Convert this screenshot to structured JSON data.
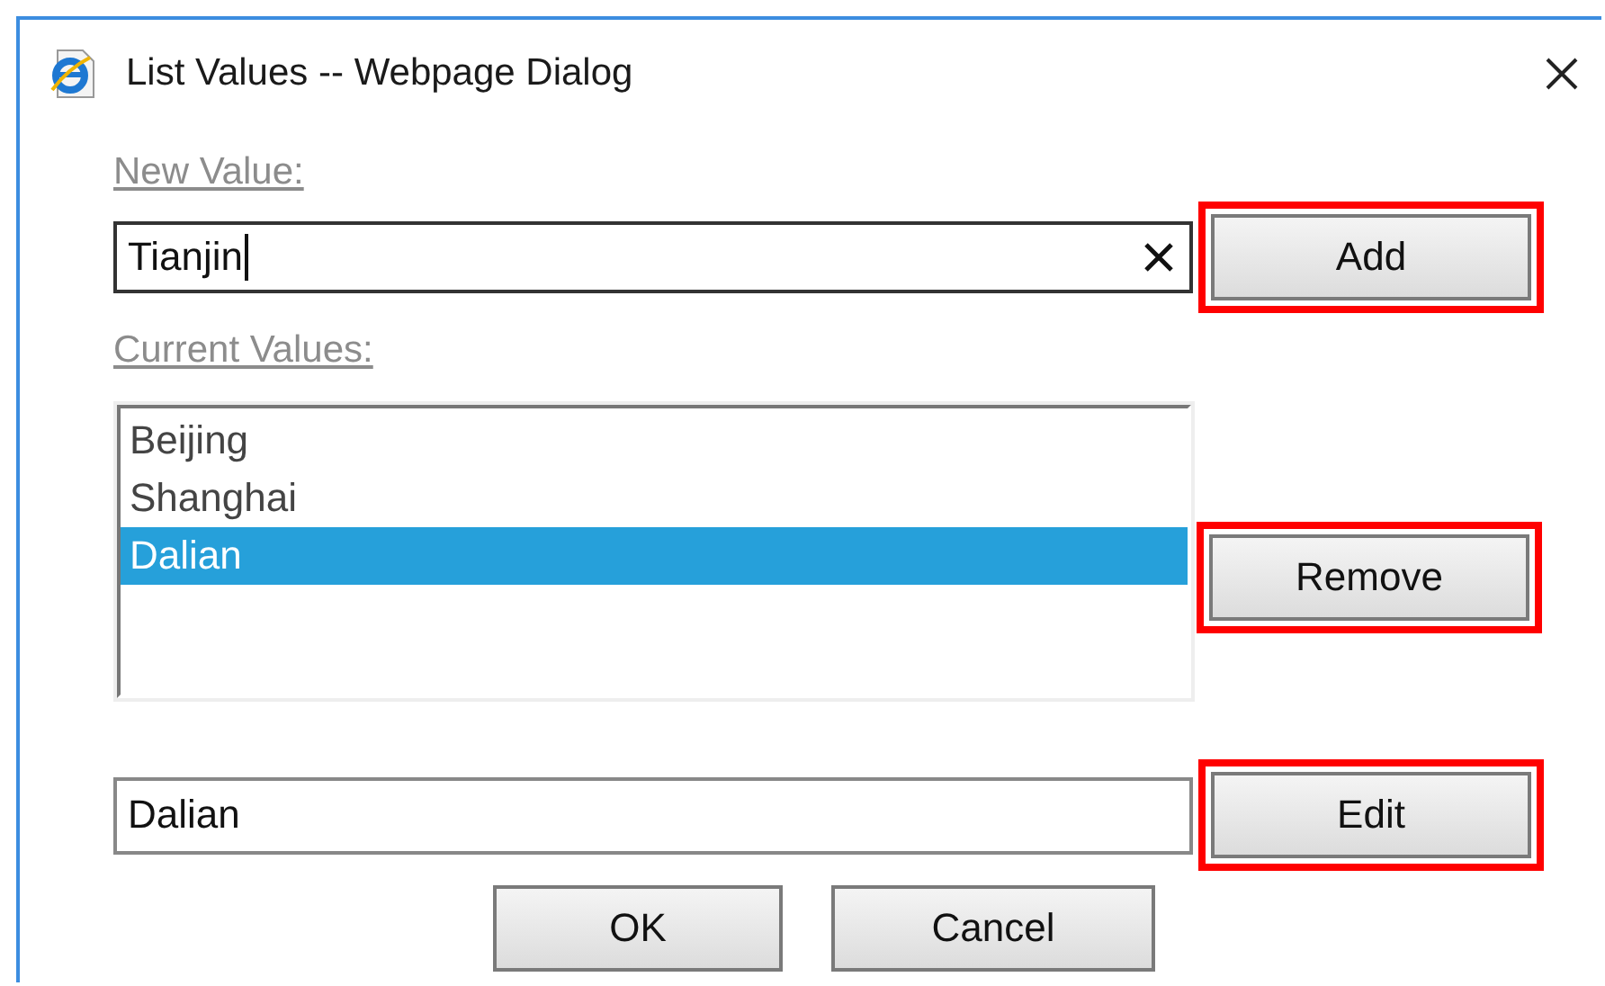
{
  "window": {
    "title": "List Values -- Webpage Dialog"
  },
  "new_value": {
    "label": "New Value:",
    "value": "Tianjin"
  },
  "add_button": {
    "label": "Add",
    "highlighted": true
  },
  "current_values": {
    "label": "Current Values:",
    "items": [
      {
        "text": "Beijing",
        "selected": false
      },
      {
        "text": "Shanghai",
        "selected": false
      },
      {
        "text": "Dalian",
        "selected": true
      }
    ]
  },
  "remove_button": {
    "label": "Remove",
    "highlighted": true
  },
  "edit_field": {
    "value": "Dalian"
  },
  "edit_button": {
    "label": "Edit",
    "highlighted": true
  },
  "buttons": [
    {
      "label": "OK"
    },
    {
      "label": "Cancel"
    }
  ]
}
